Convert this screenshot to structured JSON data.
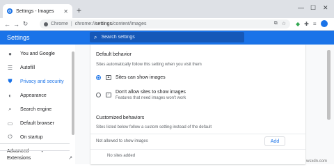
{
  "tab": {
    "title": "Settings - Images",
    "close": "✕"
  },
  "newtab": "+",
  "window": {
    "minimize": "—",
    "maximize": "☐",
    "close": "✕"
  },
  "toolbar": {
    "back": "←",
    "forward": "→",
    "reload": "↻"
  },
  "omnibox": {
    "chrome_label": "Chrome",
    "separator": "|",
    "url_scheme": "chrome://",
    "url_host": "settings",
    "url_path": "/content/images"
  },
  "settings": {
    "title": "Settings",
    "search_placeholder": "Search settings"
  },
  "sidebar": {
    "items": [
      {
        "label": "You and Google",
        "icon": "person-icon"
      },
      {
        "label": "Autofill",
        "icon": "autofill-icon"
      },
      {
        "label": "Privacy and security",
        "icon": "shield-icon",
        "active": true
      },
      {
        "label": "Appearance",
        "icon": "palette-icon"
      },
      {
        "label": "Search engine",
        "icon": "search-icon"
      },
      {
        "label": "Default browser",
        "icon": "browser-icon"
      },
      {
        "label": "On startup",
        "icon": "power-icon"
      }
    ],
    "advanced": "Advanced",
    "extensions": "Extensions"
  },
  "content": {
    "default_behavior_title": "Default behavior",
    "default_behavior_desc": "Sites automatically follow this setting when you visit them",
    "option_show": "Sites can show images",
    "option_block": "Don't allow sites to show images",
    "option_block_sub": "Features that need images won't work",
    "customized_title": "Customized behaviors",
    "customized_desc": "Sites listed below follow a custom setting instead of the default",
    "not_allowed_label": "Not allowed to show images",
    "add_label": "Add",
    "no_sites": "No sites added"
  },
  "watermark": "wsxdn.com",
  "colors": {
    "accent": "#1a73e8",
    "header": "#1a73e8"
  }
}
